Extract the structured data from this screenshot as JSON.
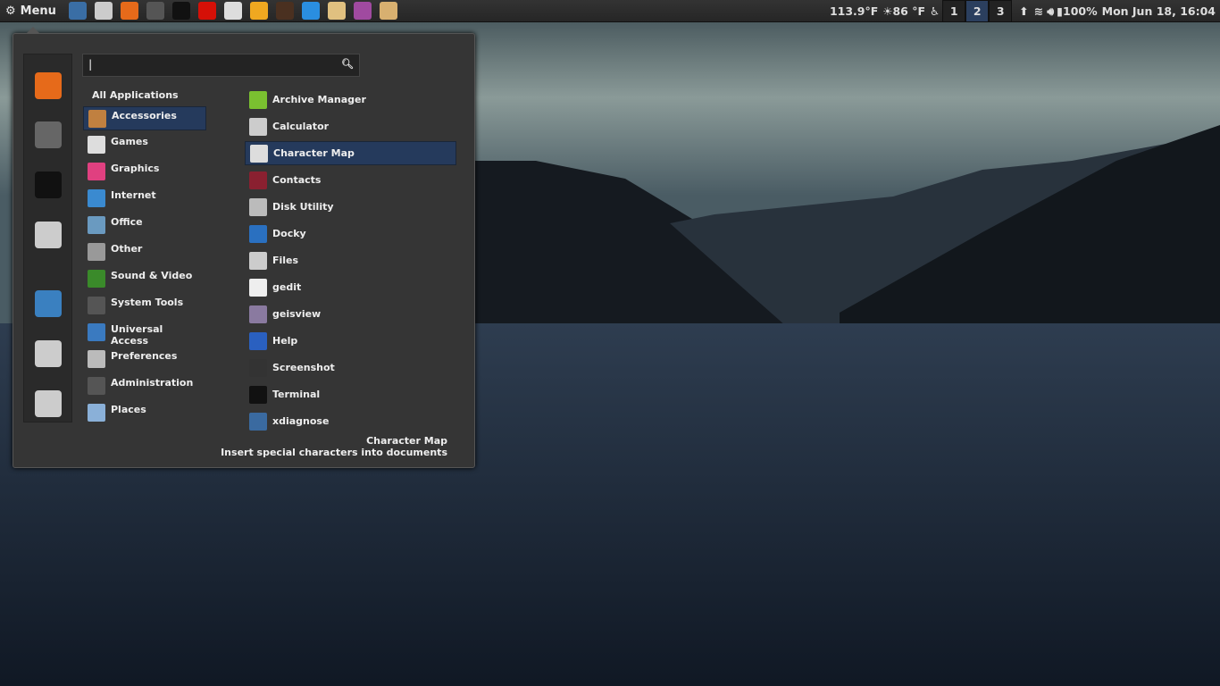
{
  "panel": {
    "menu_label": "Menu",
    "launchers": [
      {
        "icon": "desktop-settings-icon",
        "color": "#3a6ea5"
      },
      {
        "icon": "files-icon",
        "color": "#ccc"
      },
      {
        "icon": "firefox-icon",
        "color": "#e66a1a"
      },
      {
        "icon": "system-tools-icon",
        "color": "#555"
      },
      {
        "icon": "terminal-icon",
        "color": "#111"
      },
      {
        "icon": "lastfm-icon",
        "color": "#d51007"
      },
      {
        "icon": "calculator-icon",
        "color": "#ddd"
      },
      {
        "icon": "b-app-icon",
        "color": "#f0a820"
      },
      {
        "icon": "system-monitor-icon",
        "color": "#4a3020"
      },
      {
        "icon": "twitter-client-icon",
        "color": "#2a8ee0"
      },
      {
        "icon": "paint-icon",
        "color": "#e0c080"
      },
      {
        "icon": "chat-icon",
        "color": "#a04aa0"
      },
      {
        "icon": "editor-icon",
        "color": "#d8b070"
      }
    ],
    "temp_cpu": "113.9°F",
    "weather": "86 °F",
    "workspaces": [
      "1",
      "2",
      "3"
    ],
    "active_workspace": "2",
    "battery": "100%",
    "clock": "Mon Jun 18, 16:04"
  },
  "menu": {
    "search": {
      "value": "|"
    },
    "all_applications": "All Applications",
    "favorites": [
      {
        "icon": "firefox-icon",
        "color": "#e66a1a"
      },
      {
        "icon": "system-tools-icon",
        "color": "#666"
      },
      {
        "icon": "terminal-icon",
        "color": "#111"
      },
      {
        "icon": "files-icon",
        "color": "#ccc"
      },
      {
        "icon": "lock-screen-icon",
        "color": "#3a80c0"
      },
      {
        "icon": "logout-icon",
        "color": "#ccc"
      },
      {
        "icon": "power-icon",
        "color": "#ccc"
      }
    ],
    "categories": [
      {
        "label": "Accessories",
        "color": "#c08040"
      },
      {
        "label": "Games",
        "color": "#ddd"
      },
      {
        "label": "Graphics",
        "color": "#e04080"
      },
      {
        "label": "Internet",
        "color": "#3a8ad0"
      },
      {
        "label": "Office",
        "color": "#6a9ac0"
      },
      {
        "label": "Other",
        "color": "#999"
      },
      {
        "label": "Sound & Video",
        "color": "#3a8a2a"
      },
      {
        "label": "System Tools",
        "color": "#555"
      },
      {
        "label": "Universal Access",
        "color": "#3a7ac0"
      },
      {
        "label": "Preferences",
        "color": "#bbb"
      },
      {
        "label": "Administration",
        "color": "#555"
      },
      {
        "label": "Places",
        "color": "#8ab0d8"
      }
    ],
    "selected_category": "Accessories",
    "apps": [
      {
        "label": "Archive Manager",
        "color": "#7ac030"
      },
      {
        "label": "Calculator",
        "color": "#ccc"
      },
      {
        "label": "Character Map",
        "color": "#ddd"
      },
      {
        "label": "Contacts",
        "color": "#8a2030"
      },
      {
        "label": "Disk Utility",
        "color": "#bbb"
      },
      {
        "label": "Docky",
        "color": "#2a70c0"
      },
      {
        "label": "Files",
        "color": "#ccc"
      },
      {
        "label": "gedit",
        "color": "#eee"
      },
      {
        "label": "geisview",
        "color": "#8a7aa0"
      },
      {
        "label": "Help",
        "color": "#2a60c0"
      },
      {
        "label": "Screenshot",
        "color": "#333"
      },
      {
        "label": "Terminal",
        "color": "#111"
      },
      {
        "label": "xdiagnose",
        "color": "#3a6aa0"
      }
    ],
    "selected_app": "Character Map",
    "description": {
      "title": "Character Map",
      "text": "Insert special characters into documents"
    }
  }
}
